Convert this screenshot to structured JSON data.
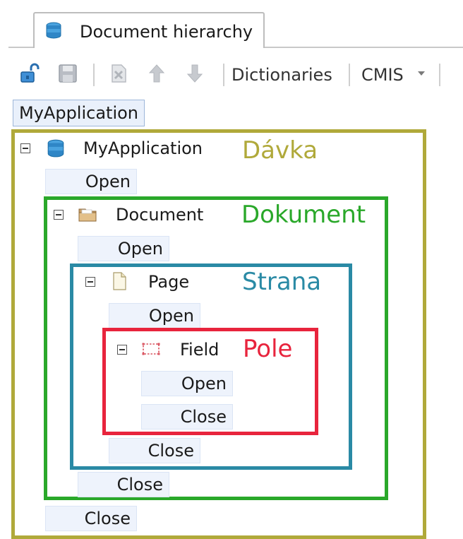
{
  "tab": {
    "label": "Document hierarchy",
    "icon": "stack-icon"
  },
  "toolbar": {
    "dictionaries": "Dictionaries",
    "cmis": "CMIS"
  },
  "breadcrumb": "MyApplication",
  "tree": {
    "application": {
      "label": "MyApplication",
      "annotation": "Dávka",
      "open": "Open",
      "close": "Close"
    },
    "document": {
      "label": "Document",
      "annotation": "Dokument",
      "open": "Open",
      "close": "Close"
    },
    "page": {
      "label": "Page",
      "annotation": "Strana",
      "open": "Open",
      "close": "Close"
    },
    "field": {
      "label": "Field",
      "annotation": "Pole",
      "open": "Open",
      "close": "Close"
    }
  },
  "colors": {
    "application_frame": "#b0a93a",
    "document_frame": "#2aa82a",
    "page_frame": "#2a8aa5",
    "field_frame": "#e8243d",
    "event_bg": "#eef3fc"
  }
}
